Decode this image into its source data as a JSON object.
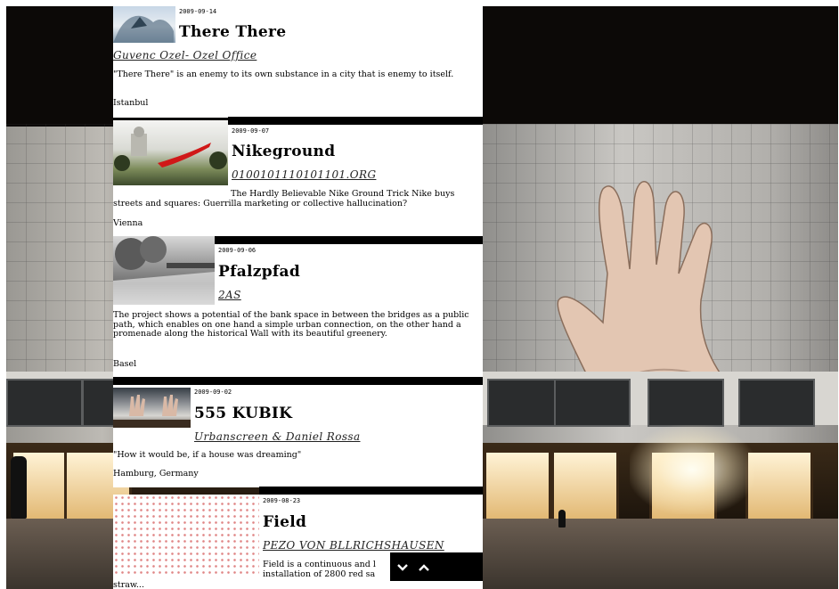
{
  "entries": [
    {
      "date": "2009-09-14",
      "title": "There There",
      "author": "Guvenc Ozel- Ozel Office",
      "description": "\"There There\" is an enemy to its own substance in a city that is enemy to itself.",
      "location": "Istanbul"
    },
    {
      "date": "2009-09-07",
      "title": "Nikeground",
      "author": "0100101110101101.ORG",
      "description": "The Hardly Believable Nike Ground Trick Nike buys streets and squares: Guerrilla marketing or collective hallucination?",
      "location": "Vienna"
    },
    {
      "date": "2009-09-06",
      "title": "Pfalzpfad",
      "author": "2AS",
      "description": "The project shows a potential of the bank space in between the bridges as a public path, which enables on one hand a simple urban connection, on the other hand a promenade along the historical Wall with its beautiful greenery.",
      "location": "Basel"
    },
    {
      "date": "2009-09-02",
      "title": "555 KUBIK",
      "author": "Urbanscreen & Daniel Rossa",
      "description": "\"How it would be, if a house was dreaming\"",
      "location": "Hamburg, Germany"
    },
    {
      "date": "2009-08-23",
      "title": "Field",
      "author": "PEZO VON BLLRICHSHAUSEN",
      "description": "Field is a continuous and l installation of 2800 red sa",
      "description_cont": "straw..."
    }
  ],
  "nav": {
    "down_icon": "chevron-down-icon",
    "up_icon": "chevron-up-icon",
    "down_glyph": "⌄",
    "up_glyph": "⌃"
  }
}
